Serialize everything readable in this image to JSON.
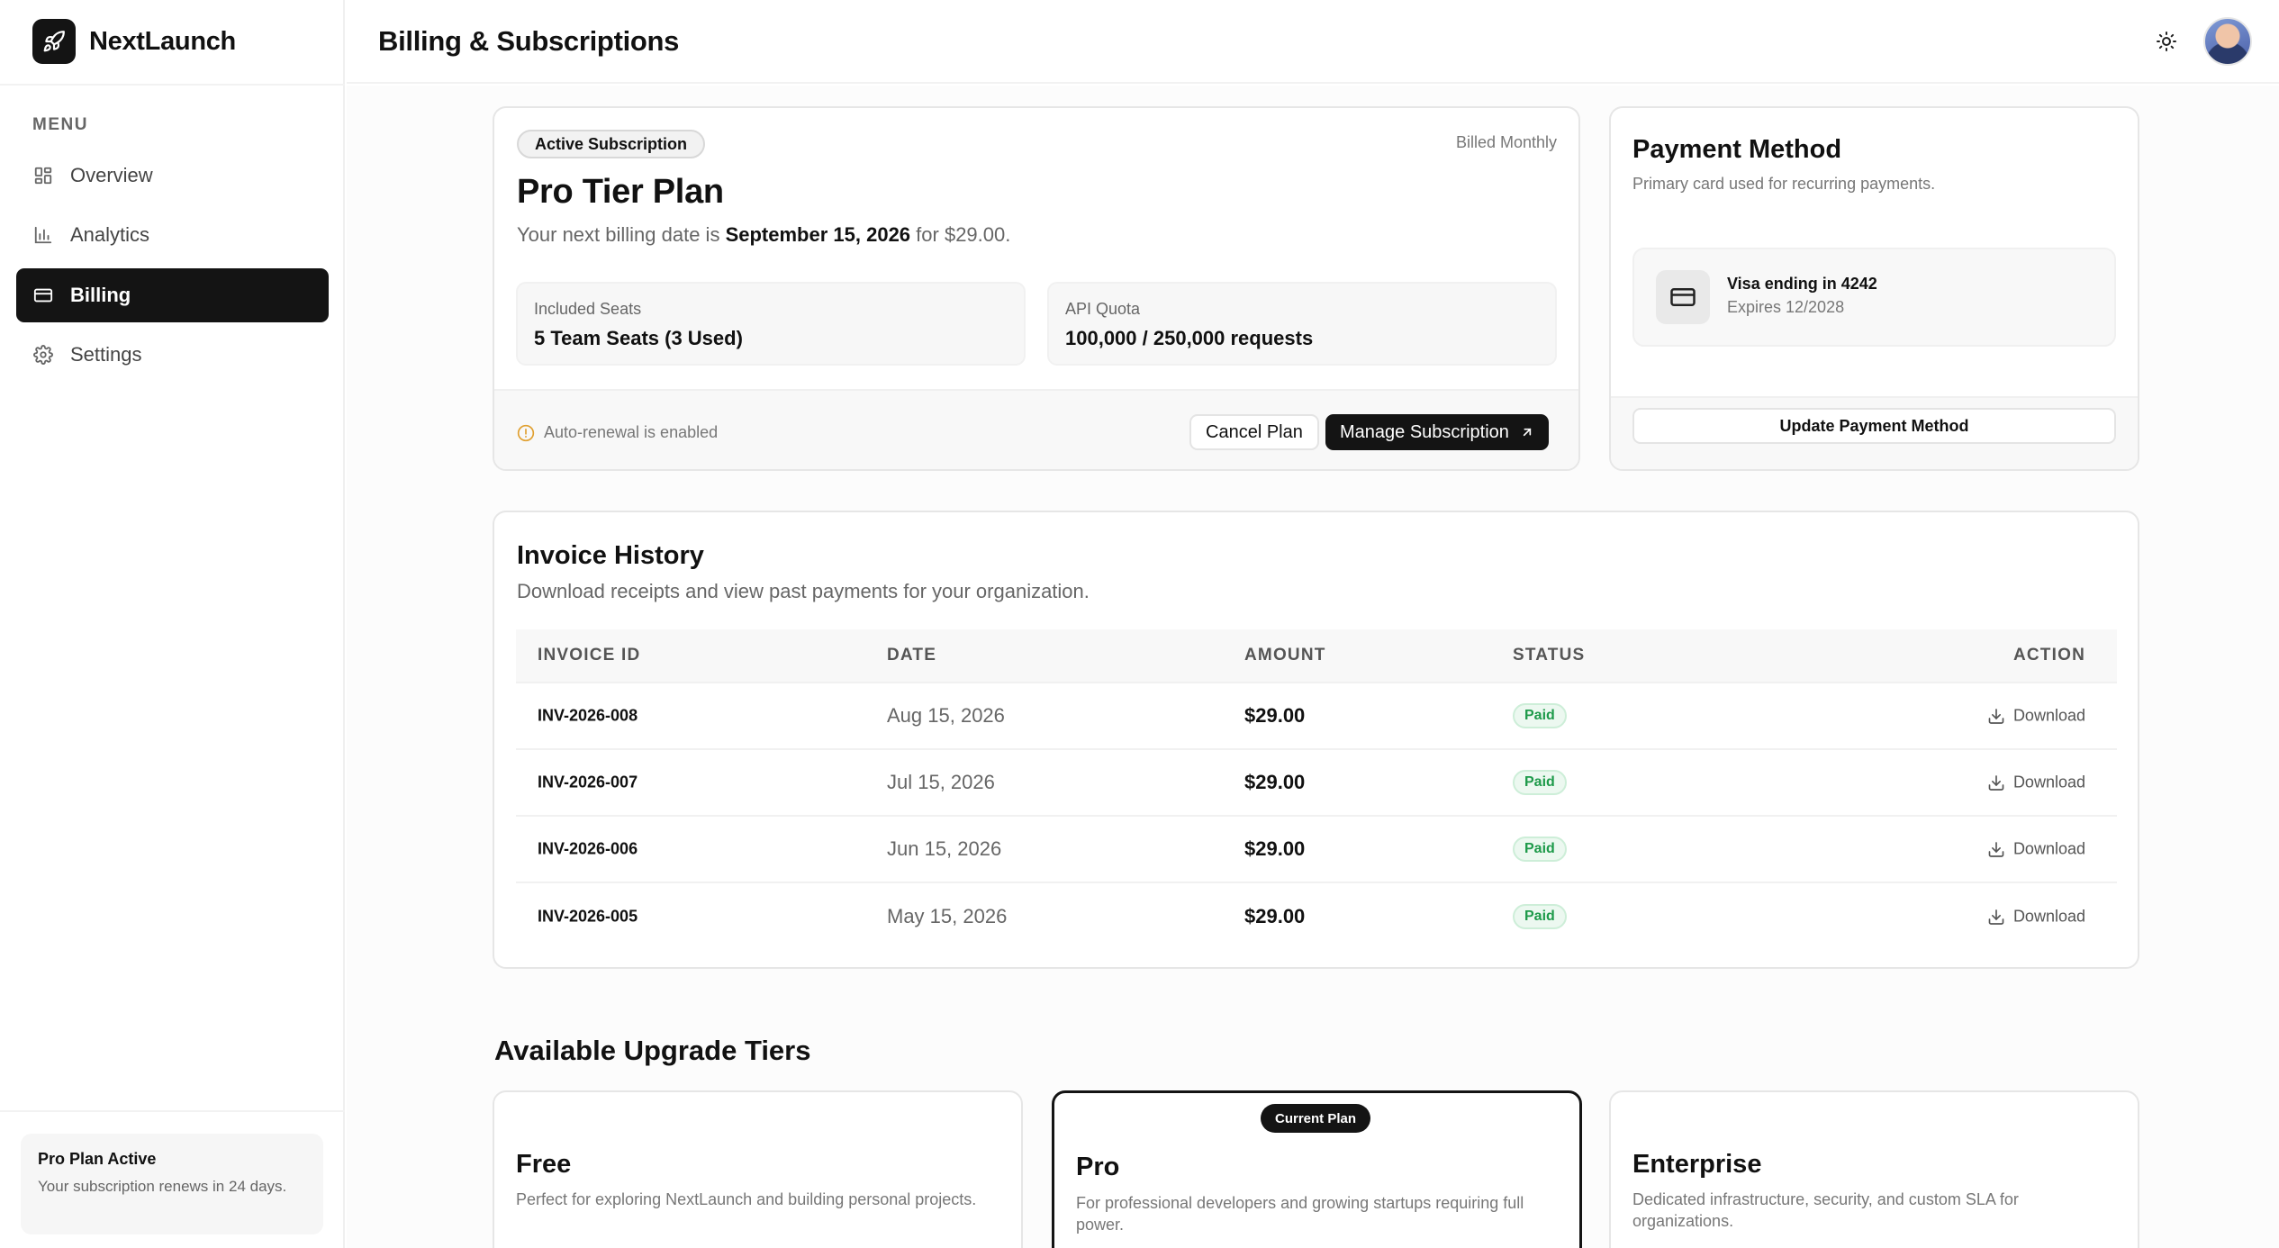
{
  "app": {
    "name": "NextLaunch",
    "logo_icon": "rocket-icon"
  },
  "sidebar": {
    "menu_heading": "MENU",
    "items": [
      {
        "label": "Overview",
        "icon": "grid-icon",
        "active": false
      },
      {
        "label": "Analytics",
        "icon": "bar-chart-icon",
        "active": false
      },
      {
        "label": "Billing",
        "icon": "credit-card-icon",
        "active": true
      },
      {
        "label": "Settings",
        "icon": "gear-icon",
        "active": false
      }
    ],
    "plan_card": {
      "title": "Pro Plan Active",
      "text": "Your subscription renews in 24 days."
    }
  },
  "header": {
    "title": "Billing & Subscriptions",
    "theme_icon": "sun-icon",
    "avatar": "avatar"
  },
  "subscription": {
    "badge": "Active Subscription",
    "billed": "Billed Monthly",
    "plan_name": "Pro Tier Plan",
    "billing_prefix": "Your next billing date is",
    "billing_date": "September 15, 2026",
    "billing_suffix": "for $29.00.",
    "stats": [
      {
        "label": "Included Seats",
        "value": "5 Team Seats (3 Used)"
      },
      {
        "label": "API Quota",
        "value": "100,000 / 250,000 requests"
      }
    ],
    "renewal_note": "Auto-renewal is enabled",
    "cancel_label": "Cancel Plan",
    "manage_label": "Manage Subscription"
  },
  "payment": {
    "title": "Payment Method",
    "subtitle": "Primary card used for recurring payments.",
    "card_name": "Visa ending in 4242",
    "card_expiry": "Expires 12/2028",
    "update_label": "Update Payment Method"
  },
  "invoices": {
    "title": "Invoice History",
    "subtitle": "Download receipts and view past payments for your organization.",
    "columns": [
      "INVOICE ID",
      "DATE",
      "AMOUNT",
      "STATUS",
      "ACTION"
    ],
    "rows": [
      {
        "id": "INV-2026-008",
        "date": "Aug 15, 2026",
        "amount": "$29.00",
        "status": "Paid",
        "action": "Download"
      },
      {
        "id": "INV-2026-007",
        "date": "Jul 15, 2026",
        "amount": "$29.00",
        "status": "Paid",
        "action": "Download"
      },
      {
        "id": "INV-2026-006",
        "date": "Jun 15, 2026",
        "amount": "$29.00",
        "status": "Paid",
        "action": "Download"
      },
      {
        "id": "INV-2026-005",
        "date": "May 15, 2026",
        "amount": "$29.00",
        "status": "Paid",
        "action": "Download"
      }
    ]
  },
  "tiers": {
    "title": "Available Upgrade Tiers",
    "current_badge": "Current Plan",
    "items": [
      {
        "name": "Free",
        "description": "Perfect for exploring NextLaunch and building personal projects.",
        "current": false
      },
      {
        "name": "Pro",
        "description": "For professional developers and growing startups requiring full power.",
        "current": true
      },
      {
        "name": "Enterprise",
        "description": "Dedicated infrastructure, security, and custom SLA for organizations.",
        "current": false
      }
    ]
  },
  "colors": {
    "accent": "#141414",
    "paid_text": "#1e9a4a",
    "paid_bg": "#ecf8f0",
    "warning": "#e0a030"
  }
}
